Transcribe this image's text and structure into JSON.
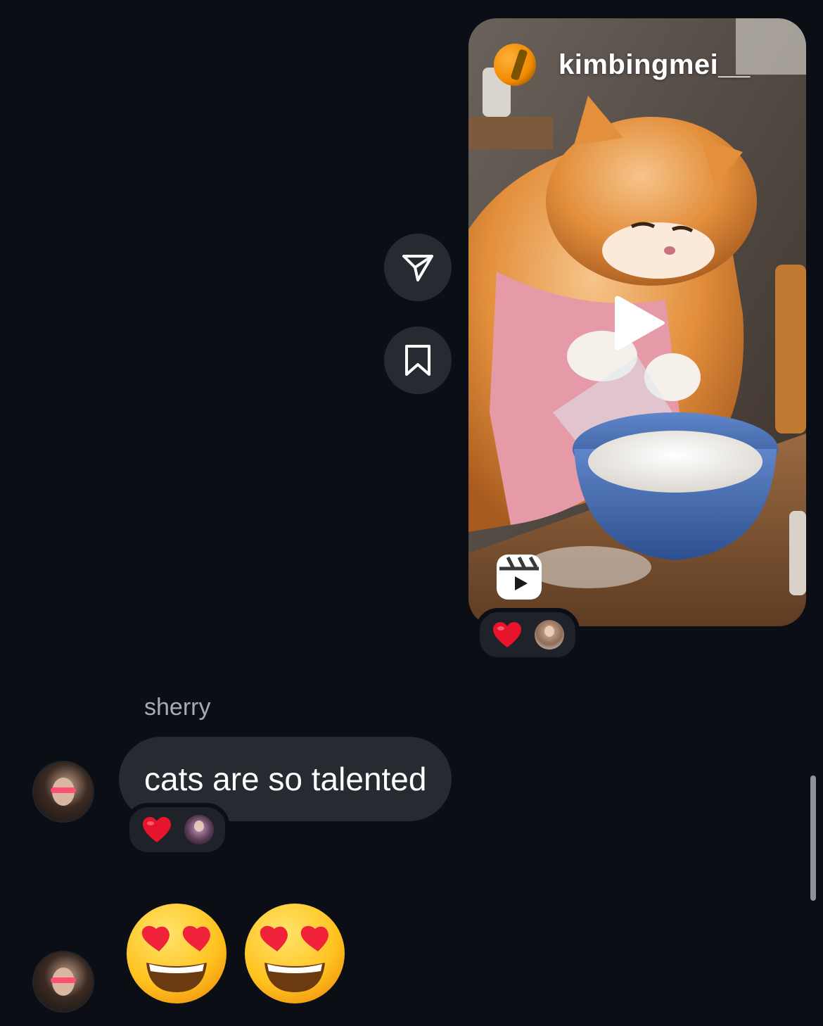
{
  "shared_reel": {
    "username": "kimbingmei__",
    "reaction": "❤️"
  },
  "side_actions": {
    "share_icon": "paper-plane-icon",
    "save_icon": "bookmark-icon"
  },
  "message": {
    "sender": "sherry",
    "text": "cats are so talented",
    "reaction": "❤️"
  },
  "emoji_message": {
    "emojis": [
      "😍",
      "😍"
    ]
  },
  "colors": {
    "background": "#0b0e14",
    "bubble": "#262a31",
    "sender_name": "#a7abb2",
    "heart": "#e8142c"
  }
}
